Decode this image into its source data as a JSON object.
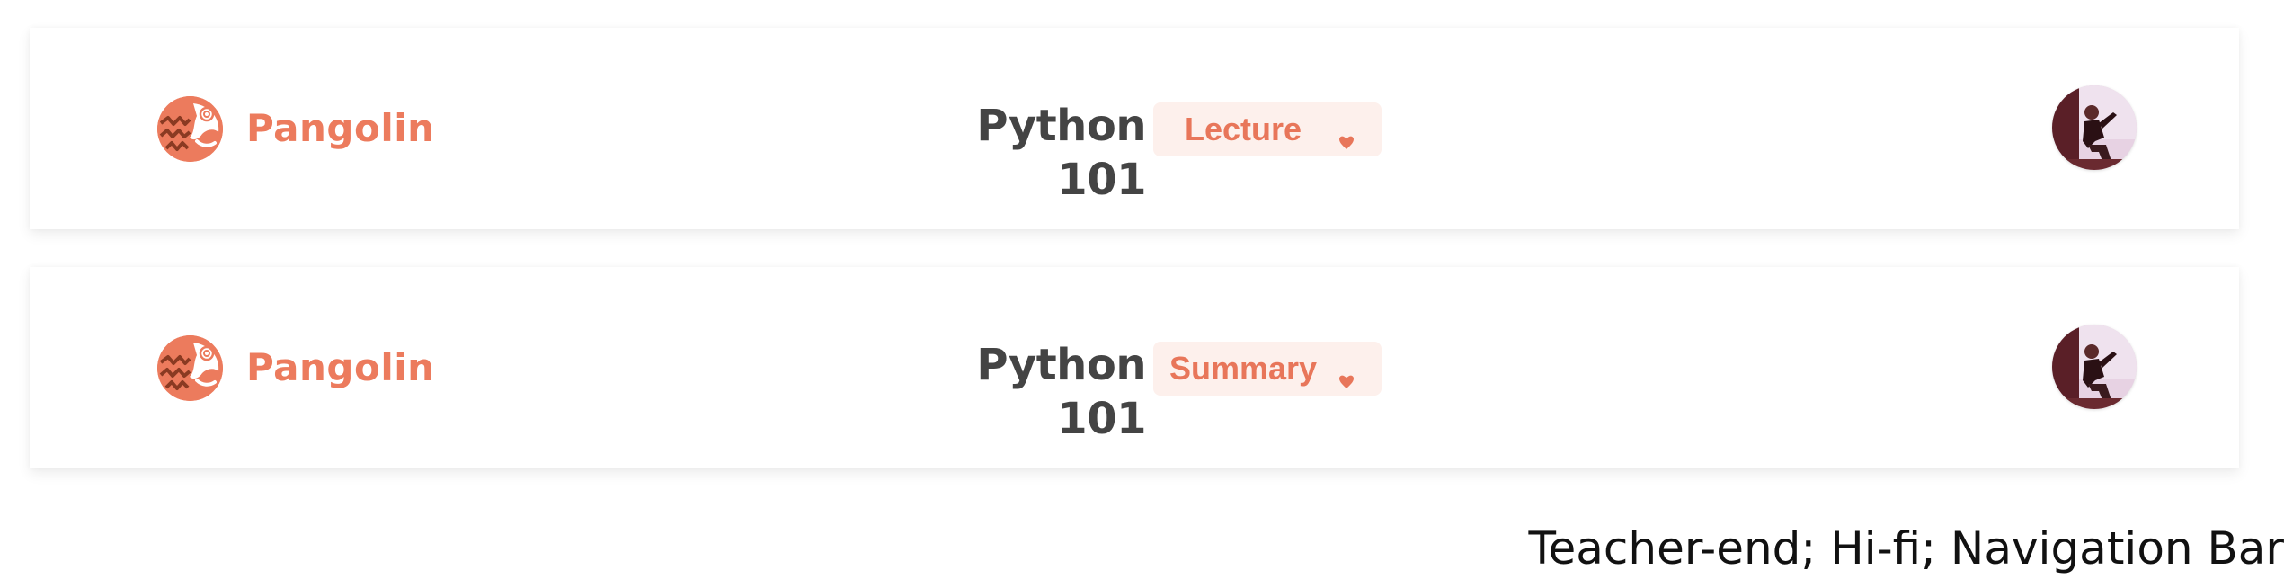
{
  "navbars": [
    {
      "brand": {
        "name": "Pangolin",
        "logo_icon": "pangolin-logo-icon"
      },
      "course_title": "Python 101",
      "mode_selector": {
        "selected": "Lecture",
        "icon": "caret-down-icon"
      },
      "avatar_icon": "user-avatar-icon"
    },
    {
      "brand": {
        "name": "Pangolin",
        "logo_icon": "pangolin-logo-icon"
      },
      "course_title": "Python 101",
      "mode_selector": {
        "selected": "Summary",
        "icon": "caret-down-icon"
      },
      "avatar_icon": "user-avatar-icon"
    }
  ],
  "caption": "Teacher-end; Hi-fi; Navigation Bar",
  "colors": {
    "brand": "#ec7b5d",
    "title": "#444444",
    "selector_bg": "#fdf0ec",
    "selector_text": "#e8765a",
    "background": "#ffffff"
  }
}
